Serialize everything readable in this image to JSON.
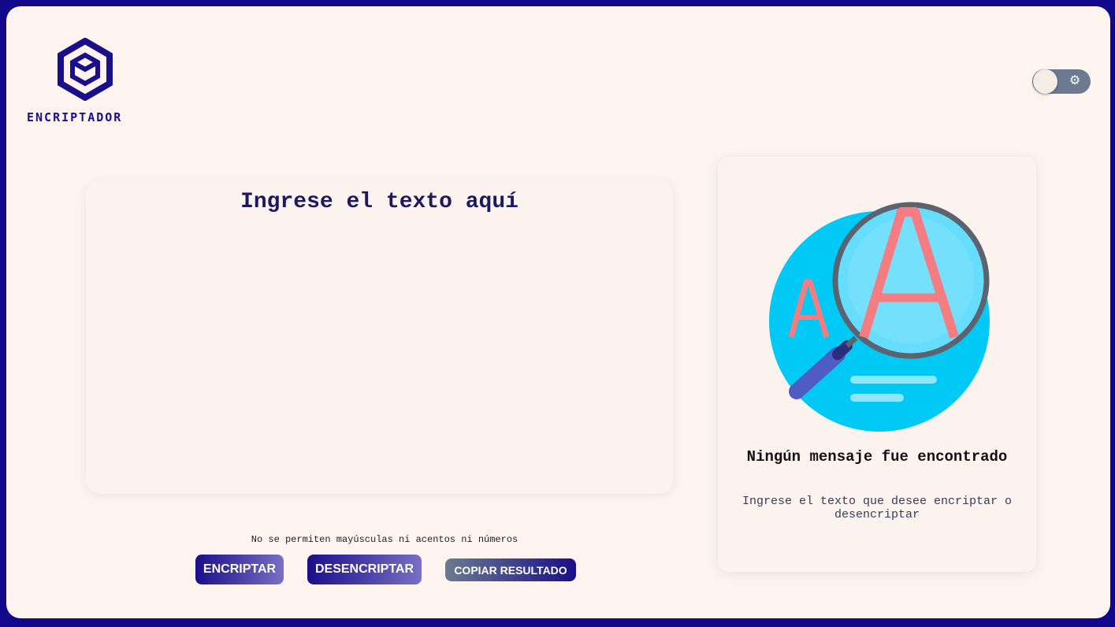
{
  "brand": {
    "name": "ENCRIPTADOR",
    "logo_icon": "hexagon-cube-icon",
    "color": "#1a0f8a"
  },
  "theme_toggle": {
    "icon": "gear-icon",
    "state": "off"
  },
  "input": {
    "placeholder": "Ingrese el texto aquí",
    "value": ""
  },
  "warning": "No se permiten mayúsculas ni acentos ni números",
  "buttons": {
    "encrypt": "ENCRIPTAR",
    "decrypt": "DESENCRIPTAR",
    "copy": "COPIAR RESULTADO"
  },
  "output": {
    "illustration": "magnifier-letters-icon",
    "title": "Ningún mensaje fue encontrado",
    "subtitle": "Ingrese el texto que desee encriptar o desencriptar"
  },
  "colors": {
    "frame": "#10078a",
    "background": "#fdf4ef",
    "primary": "#1a0f8a",
    "secondary": "#6b7a90"
  }
}
